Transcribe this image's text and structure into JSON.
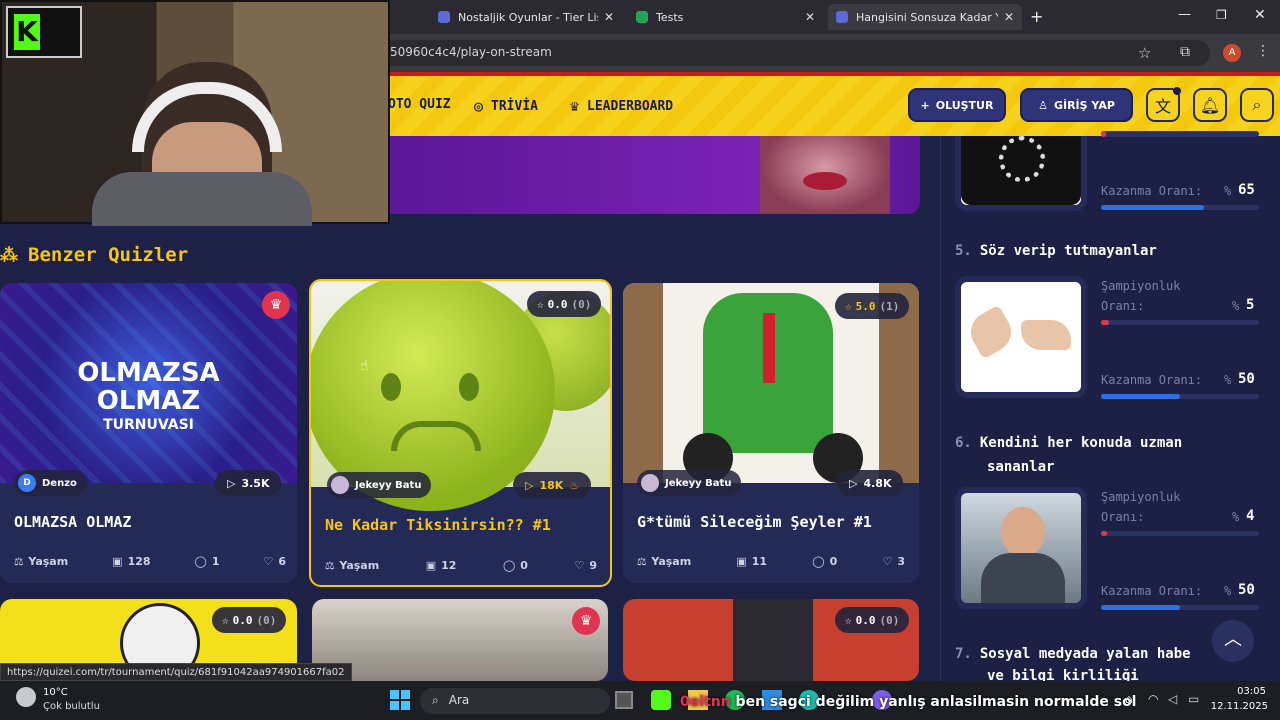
{
  "browser": {
    "tabs": [
      {
        "label": "Nostaljik Oyunlar - Tier List, Kö"
      },
      {
        "label": "Tests"
      },
      {
        "label": "Hangisini Sonsuza Kadar Yasakl"
      }
    ],
    "url": "50960c4c4/play-on-stream",
    "profile_letter": "A"
  },
  "nav": {
    "photo_quiz": "OTO QUIZ",
    "trivia": "TRİVİA",
    "leaderboard": "LEADERBOARD",
    "create": "OLUŞTUR",
    "login": "GİRİŞ YAP"
  },
  "section_title": "Benzer Quizler",
  "cards": [
    {
      "author": "Denzo",
      "plays": "3.5K",
      "title": "OLMAZSA OLMAZ",
      "category": "Yaşam",
      "questions": "128",
      "comments": "1",
      "likes": "6",
      "poster_line1": "OLMAZSA",
      "poster_line2": "OLMAZ",
      "poster_line3": "TURNUVASI",
      "title_color": "#ffffff"
    },
    {
      "author": "Jekeyy Batu",
      "plays": "18K",
      "title": "Ne Kadar Tiksinirsin?? #1",
      "category": "Yaşam",
      "questions": "12",
      "comments": "0",
      "likes": "9",
      "rating": "0.0",
      "rating_count": "(0)",
      "title_color": "#f5c518"
    },
    {
      "author": "Jekeyy Batu",
      "plays": "4.8K",
      "title": "G*tümü Sileceğim Şeyler #1",
      "category": "Yaşam",
      "questions": "11",
      "comments": "0",
      "likes": "3",
      "rating": "5.0",
      "rating_count": "(1)",
      "title_color": "#ffffff"
    },
    {
      "rating": "0.0",
      "rating_count": "(0)"
    },
    {},
    {
      "rating": "0.0",
      "rating_count": "(0)"
    }
  ],
  "leaderboard": {
    "champ_label_1": "Şampiyonluk",
    "champ_label_2": "Oranı:",
    "win_label": "Kazanma Oranı:",
    "percent": "%",
    "items": [
      {
        "rank": "",
        "title": "",
        "champ": "",
        "win": "65",
        "champ_frac": 0.03,
        "win_frac": 0.65
      },
      {
        "rank": "5.",
        "title": "Söz verip tutmayanlar",
        "champ": "5",
        "win": "50",
        "champ_frac": 0.05,
        "win_frac": 0.5
      },
      {
        "rank": "6.",
        "title": "Kendini her konuda uzman",
        "title2": "sananlar",
        "champ": "4",
        "win": "50",
        "champ_frac": 0.04,
        "win_frac": 0.5
      },
      {
        "rank": "7.",
        "title": "Sosyal medyada yalan habe",
        "title2": "ve bilgi kirliliği"
      }
    ]
  },
  "status_url": "https://quizei.com/tr/tournament/quiz/681f91042aa974901667fa02",
  "taskbar": {
    "weather_temp": "10°C",
    "weather_desc": "Çok bulutlu",
    "search": "Ara",
    "time": "03:05",
    "date": "12.11.2025",
    "chat_overlay": "ben sagci değilim yanlış anlasilmasin normalde sol",
    "chat_user": "0eitnn"
  },
  "colors": {
    "accent_yellow": "#f5c518",
    "header_yellow": "#f7d21c",
    "navy": "#2f3378",
    "win_bar": "#2e6ee6",
    "champ_bar": "#e0344f"
  }
}
